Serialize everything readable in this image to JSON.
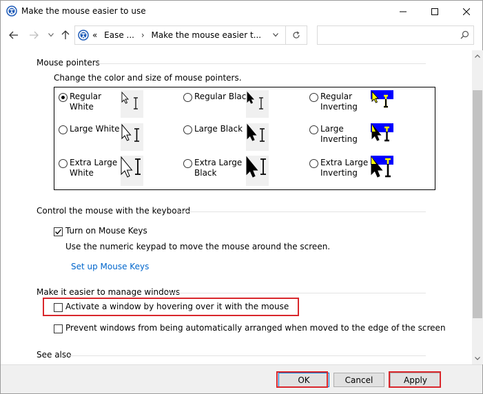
{
  "window": {
    "title": "Make the mouse easier to use"
  },
  "address": {
    "chevrons": "«",
    "crumbs": [
      "Ease ...",
      "Make the mouse easier t..."
    ],
    "separator": "›"
  },
  "search": {
    "placeholder": ""
  },
  "pointers": {
    "heading": "Mouse pointers",
    "description": "Change the color and size of mouse pointers.",
    "options": [
      {
        "label_line1": "Regular",
        "label_line2": "White",
        "selected": true
      },
      {
        "label_line1": "Regular Black",
        "label_line2": "",
        "selected": false
      },
      {
        "label_line1": "Regular",
        "label_line2": "Inverting",
        "selected": false
      },
      {
        "label_line1": "Large White",
        "label_line2": "",
        "selected": false
      },
      {
        "label_line1": "Large Black",
        "label_line2": "",
        "selected": false
      },
      {
        "label_line1": "Large",
        "label_line2": "Inverting",
        "selected": false
      },
      {
        "label_line1": "Extra Large",
        "label_line2": "White",
        "selected": false
      },
      {
        "label_line1": "Extra Large",
        "label_line2": "Black",
        "selected": false
      },
      {
        "label_line1": "Extra Large",
        "label_line2": "Inverting",
        "selected": false
      }
    ]
  },
  "keyboard": {
    "heading": "Control the mouse with the keyboard",
    "mouse_keys_label": "Turn on Mouse Keys",
    "mouse_keys_checked": true,
    "description": "Use the numeric keypad to move the mouse around the screen.",
    "setup_link": "Set up Mouse Keys"
  },
  "windows": {
    "heading": "Make it easier to manage windows",
    "hover_label": "Activate a window by hovering over it with the mouse",
    "hover_checked": false,
    "prevent_label": "Prevent windows from being automatically arranged when moved to the edge of the screen",
    "prevent_checked": false
  },
  "see_also": {
    "heading": "See also"
  },
  "footer": {
    "ok_label": "OK",
    "cancel_label": "Cancel",
    "apply_label": "Apply"
  },
  "colors": {
    "highlight": "#d9262b",
    "link": "#0066cc",
    "inverting_bg": "#0000ff",
    "inverting_accent": "#ffff00"
  }
}
